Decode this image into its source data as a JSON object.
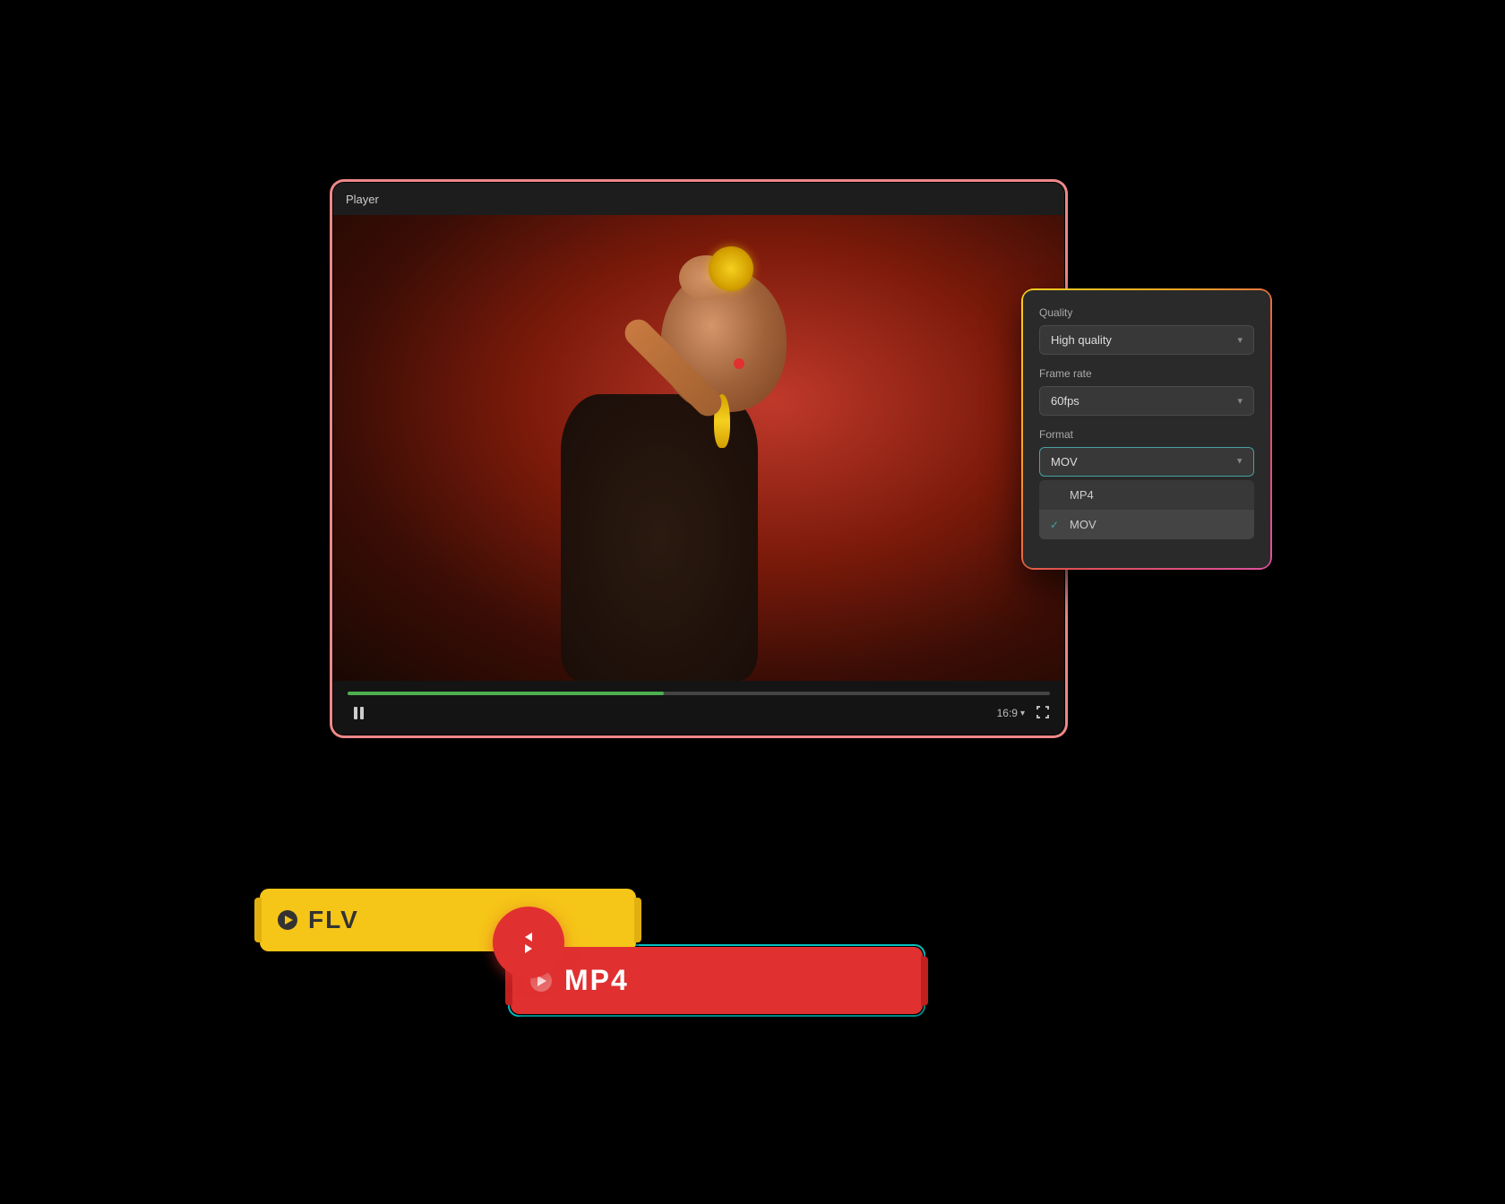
{
  "player": {
    "title": "Player",
    "aspect_ratio": "16:9",
    "aspect_ratio_chevron": "▾",
    "fullscreen_icon": "⛶",
    "progress_percent": 45
  },
  "settings_panel": {
    "quality_label": "Quality",
    "quality_value": "High quality",
    "quality_chevron": "▾",
    "framerate_label": "Frame rate",
    "framerate_value": "60fps",
    "framerate_chevron": "▾",
    "format_label": "Format",
    "format_value": "MOV",
    "format_chevron_up": "▴",
    "format_options": [
      {
        "name": "MP4",
        "selected": false
      },
      {
        "name": "MOV",
        "selected": true
      }
    ]
  },
  "format_badges": {
    "source_format": "FLV",
    "target_format": "MP4"
  },
  "icons": {
    "pause": "pause",
    "play": "play",
    "convert": "convert-arrows",
    "chevron_down": "▾",
    "chevron_up": "▴",
    "check": "✓"
  }
}
